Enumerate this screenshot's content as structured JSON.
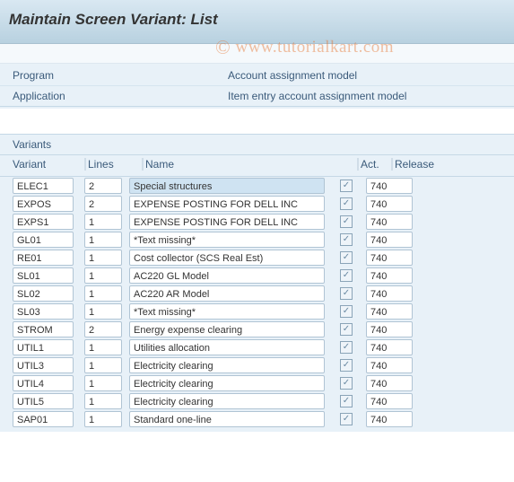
{
  "header": {
    "title": "Maintain Screen Variant: List"
  },
  "watermark": {
    "text": "www.tutorialkart.com"
  },
  "info": {
    "program_label": "Program",
    "program_value": "Account assignment model",
    "application_label": "Application",
    "application_value": "Item entry account assignment model"
  },
  "grid": {
    "title": "Variants",
    "headers": {
      "variant": "Variant",
      "lines": "Lines",
      "name": "Name",
      "act": "Act.",
      "release": "Release"
    },
    "rows": [
      {
        "variant": "ELEC1",
        "lines": "2",
        "name": "Special structures",
        "act": true,
        "release": "740",
        "highlight": true
      },
      {
        "variant": "EXPOS",
        "lines": "2",
        "name": "EXPENSE POSTING FOR DELL INC",
        "act": true,
        "release": "740"
      },
      {
        "variant": "EXPS1",
        "lines": "1",
        "name": "EXPENSE POSTING FOR DELL INC",
        "act": true,
        "release": "740"
      },
      {
        "variant": "GL01",
        "lines": "1",
        "name": "*Text missing*",
        "act": true,
        "release": "740"
      },
      {
        "variant": "RE01",
        "lines": "1",
        "name": "Cost collector (SCS Real Est)",
        "act": true,
        "release": "740"
      },
      {
        "variant": "SL01",
        "lines": "1",
        "name": "AC220 GL Model",
        "act": true,
        "release": "740"
      },
      {
        "variant": "SL02",
        "lines": "1",
        "name": "AC220  AR  Model",
        "act": true,
        "release": "740"
      },
      {
        "variant": "SL03",
        "lines": "1",
        "name": "*Text missing*",
        "act": true,
        "release": "740"
      },
      {
        "variant": "STROM",
        "lines": "2",
        "name": "Energy expense clearing",
        "act": true,
        "release": "740"
      },
      {
        "variant": "UTIL1",
        "lines": "1",
        "name": "Utilities allocation",
        "act": true,
        "release": "740"
      },
      {
        "variant": "UTIL3",
        "lines": "1",
        "name": "Electricity clearing",
        "act": true,
        "release": "740"
      },
      {
        "variant": "UTIL4",
        "lines": "1",
        "name": "Electricity clearing",
        "act": true,
        "release": "740"
      },
      {
        "variant": "UTIL5",
        "lines": "1",
        "name": "Electricity clearing",
        "act": true,
        "release": "740"
      },
      {
        "variant": "SAP01",
        "lines": "1",
        "name": "Standard one-line",
        "act": true,
        "release": "740"
      }
    ]
  }
}
